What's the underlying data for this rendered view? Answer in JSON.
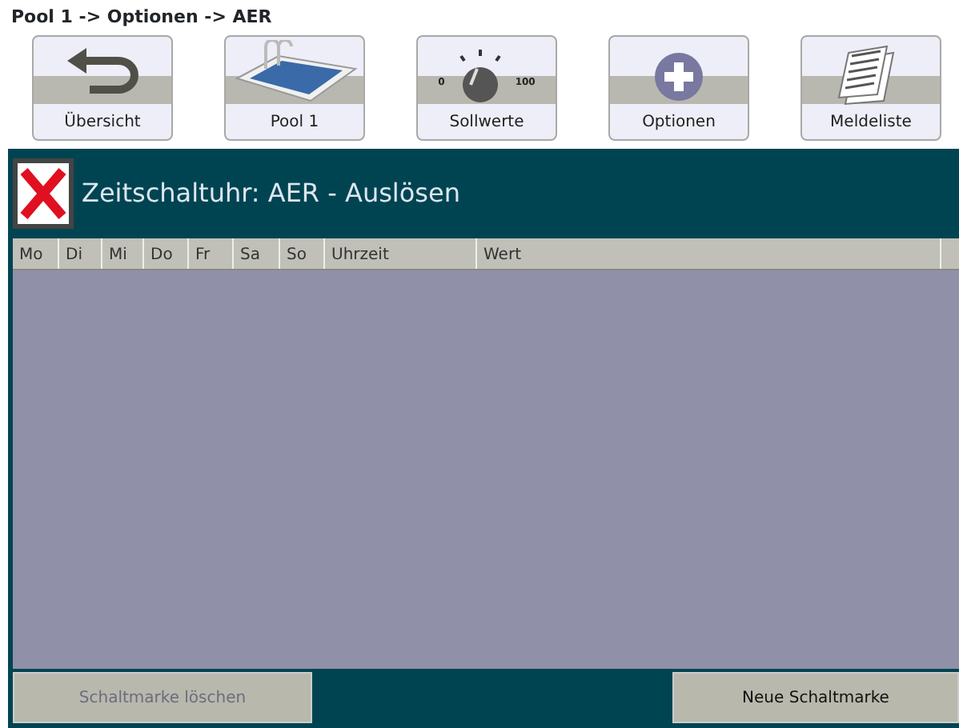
{
  "breadcrumb": "Pool 1 -> Optionen -> AER",
  "nav_buttons": [
    {
      "label": "Übersicht",
      "kind": "back"
    },
    {
      "label": "Pool 1",
      "kind": "pool"
    },
    {
      "label": "Sollwerte",
      "kind": "dial",
      "scale_min": "0",
      "scale_max": "100"
    },
    {
      "label": "Optionen",
      "kind": "plus"
    },
    {
      "label": "Meldeliste",
      "kind": "list"
    }
  ],
  "panel": {
    "title": "Zeitschaltuhr: AER - Auslösen"
  },
  "table": {
    "columns": [
      "Mo",
      "Di",
      "Mi",
      "Do",
      "Fr",
      "Sa",
      "So",
      "Uhrzeit",
      "Wert"
    ]
  },
  "actions": [
    {
      "label": "Schaltmarke löschen",
      "disabled": true
    },
    {
      "label": "Neue Schaltmarke",
      "disabled": false
    }
  ]
}
